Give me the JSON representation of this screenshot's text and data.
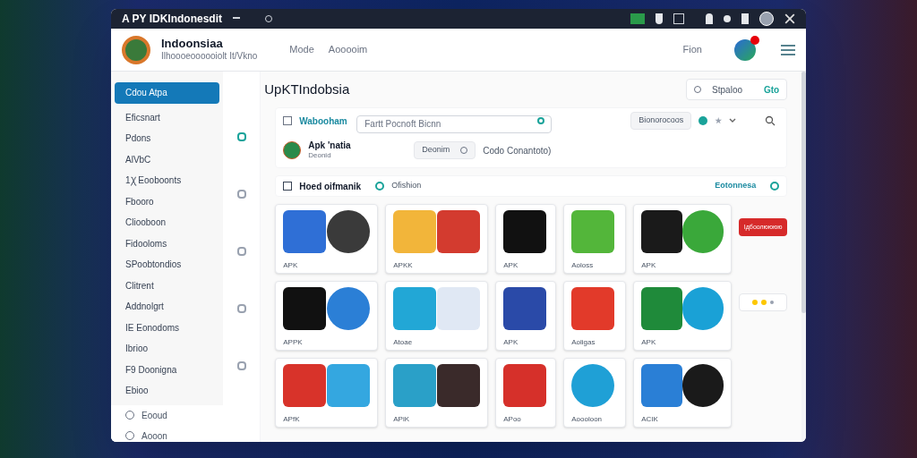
{
  "window": {
    "title": "A PY IDKIndonesdit"
  },
  "header": {
    "site_name": "Indoonsiaa",
    "tagline": "Ilhoooeoooooiolt It/Vkno",
    "nav": [
      "Mode",
      "Aooooim"
    ],
    "right_link": "Fion",
    "notification": true
  },
  "sidebar": {
    "items": [
      {
        "label": "Cdou Atpa",
        "selected": true
      },
      {
        "label": "Eficsnart",
        "selected": false
      },
      {
        "label": "Pdons",
        "selected": false
      },
      {
        "label": "AlVbC",
        "selected": false
      },
      {
        "label": "1Ꭓ Eooboonts",
        "selected": false
      },
      {
        "label": "Fbooro",
        "selected": false
      },
      {
        "label": "Cliooboon",
        "selected": false
      },
      {
        "label": "Fidooloms",
        "selected": false
      },
      {
        "label": "SPoobtondios",
        "selected": false
      },
      {
        "label": "Clitrent",
        "selected": false
      },
      {
        "label": "Addnolgrt",
        "selected": false
      },
      {
        "label": "IE Eonodoms",
        "selected": false
      },
      {
        "label": "Ibrioo",
        "selected": false
      },
      {
        "label": "F9 Doonigna",
        "selected": false
      },
      {
        "label": "Ebioo",
        "selected": false
      }
    ],
    "footer": [
      {
        "label": "Eooud"
      },
      {
        "label": "Aooon"
      }
    ]
  },
  "rail": {
    "items": [
      {
        "selected": true
      },
      {
        "selected": false
      },
      {
        "selected": false
      },
      {
        "selected": false
      },
      {
        "selected": false
      }
    ]
  },
  "main": {
    "title": "UpKTIndobsia",
    "signin": {
      "label": "Stpaloo",
      "action": "Gto"
    },
    "toolbar": {
      "tab": "Wabooham",
      "search_placeholder": "Fartt Pocnoft Bicnn",
      "sort": "Bionorocoos"
    },
    "profile": {
      "name": "Apk 'natia",
      "sub": "Deonid",
      "chip": "Deonim",
      "detail": "Codo Conantoto)"
    },
    "section": {
      "title": "Hoed oifmanik",
      "badge": "Ofishion",
      "link": "Eotonnesa"
    },
    "cards": [
      {
        "label": "APK",
        "icons": [
          {
            "kind": "square",
            "color": "#2f6fd6"
          },
          {
            "kind": "circle",
            "color": "#3a3a3a"
          }
        ]
      },
      {
        "label": "APKK",
        "icons": [
          {
            "kind": "square",
            "color": "#f2b53a"
          },
          {
            "kind": "square",
            "color": "#d33b2f"
          }
        ]
      },
      {
        "label": "APK",
        "icons": [
          {
            "kind": "square",
            "color": "#111111"
          }
        ]
      },
      {
        "label": "Aoloss",
        "icons": [
          {
            "kind": "square",
            "color": "#53b63a"
          }
        ]
      },
      {
        "label": "APK",
        "icons": [
          {
            "kind": "square",
            "color": "#1a1a1a"
          },
          {
            "kind": "circle",
            "color": "#3aa83a"
          }
        ]
      },
      {
        "label": "APPK",
        "icons": [
          {
            "kind": "square",
            "color": "#111111"
          },
          {
            "kind": "circle",
            "color": "#2b7fd6"
          }
        ]
      },
      {
        "label": "Atoae",
        "icons": [
          {
            "kind": "square",
            "color": "#22a7d6"
          },
          {
            "kind": "square",
            "color": "#e0e8f4"
          }
        ]
      },
      {
        "label": "APK",
        "icons": [
          {
            "kind": "square",
            "color": "#2a4aa8"
          }
        ]
      },
      {
        "label": "Aoligas",
        "icons": [
          {
            "kind": "square",
            "color": "#e23a2a"
          }
        ]
      },
      {
        "label": "APK",
        "icons": [
          {
            "kind": "square",
            "color": "#1f8a3a"
          },
          {
            "kind": "circle",
            "color": "#1aa1d6"
          }
        ]
      },
      {
        "label": "APfK",
        "icons": [
          {
            "kind": "square",
            "color": "#d8332a"
          },
          {
            "kind": "square",
            "color": "#34a7e0"
          }
        ]
      },
      {
        "label": "APiK",
        "icons": [
          {
            "kind": "square",
            "color": "#2aa0c8"
          },
          {
            "kind": "square",
            "color": "#3a2a2a"
          }
        ]
      },
      {
        "label": "APoo",
        "icons": [
          {
            "kind": "square",
            "color": "#d6302a"
          }
        ]
      },
      {
        "label": "Aoooloon",
        "icons": [
          {
            "kind": "circle",
            "color": "#1fa0d6"
          }
        ]
      },
      {
        "label": "ACIK",
        "icons": [
          {
            "kind": "square",
            "color": "#2a7fd6"
          },
          {
            "kind": "circle",
            "color": "#1a1a1a"
          }
        ]
      }
    ],
    "promo_button": "Ідбоолюююю"
  }
}
